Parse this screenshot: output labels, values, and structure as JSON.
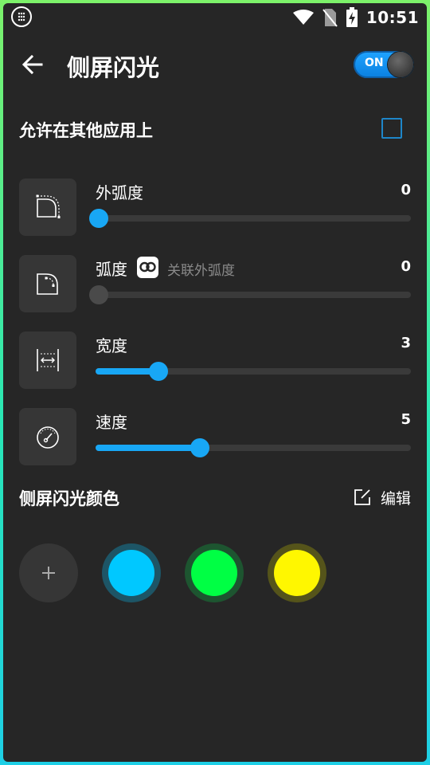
{
  "status_bar": {
    "time": "10:51"
  },
  "app_bar": {
    "title": "侧屏闪光",
    "toggle_label": "ON",
    "toggle_on": true
  },
  "overlay": {
    "label": "允许在其他应用上",
    "checked": false
  },
  "sliders": [
    {
      "label": "外弧度",
      "value": "0",
      "fraction": 0.0,
      "icon": "outer-corner-radius-icon",
      "enabled": true
    },
    {
      "label": "弧度",
      "value": "0",
      "fraction": 0.0,
      "icon": "corner-radius-icon",
      "enabled": false,
      "link_text": "关联外弧度"
    },
    {
      "label": "宽度",
      "value": "3",
      "fraction": 0.2,
      "icon": "width-icon",
      "enabled": true
    },
    {
      "label": "速度",
      "value": "5",
      "fraction": 0.33,
      "icon": "speed-gauge-icon",
      "enabled": true
    }
  ],
  "colors_section": {
    "title": "侧屏闪光颜色",
    "edit_label": "编辑",
    "colors": [
      {
        "hex": "#00c8ff",
        "ring": "#1d5566"
      },
      {
        "hex": "#00ff44",
        "ring": "#1d5530"
      },
      {
        "hex": "#fff700",
        "ring": "#55541a"
      }
    ]
  },
  "theme": {
    "accent": "#18a7f5",
    "background": "#262626"
  }
}
